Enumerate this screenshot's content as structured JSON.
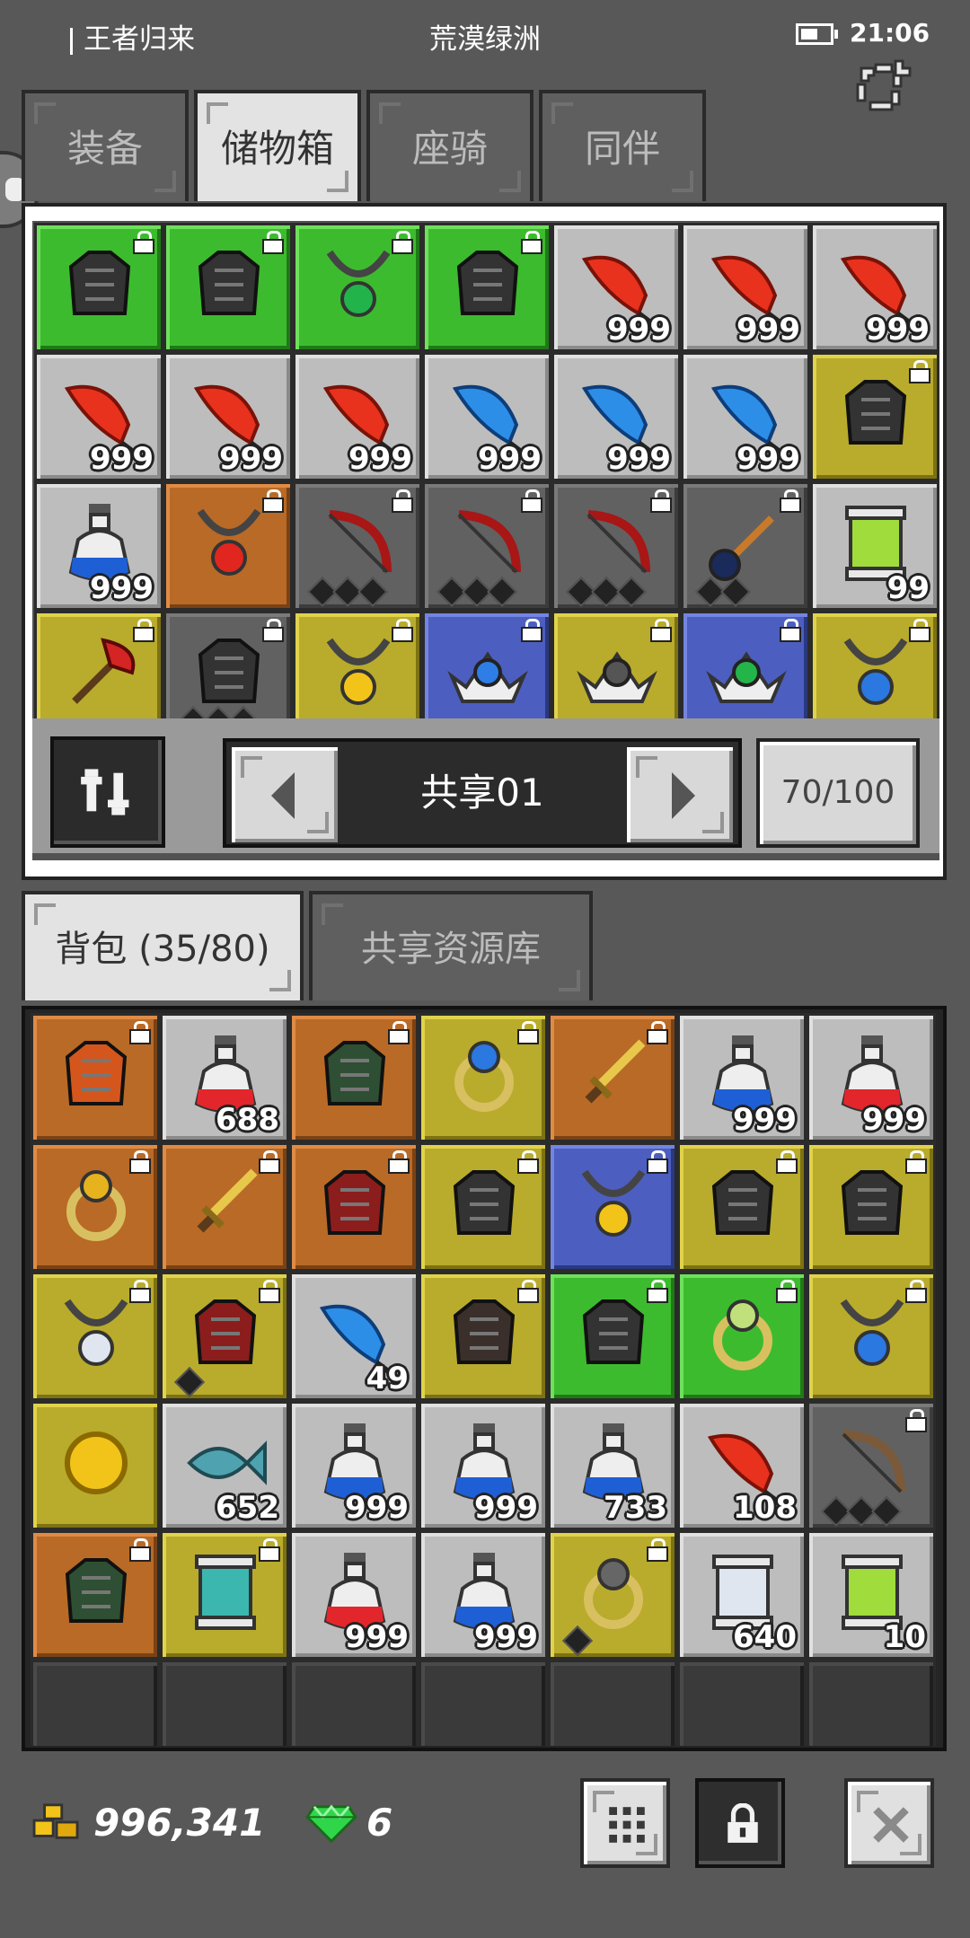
{
  "status_bar": {
    "carrier": "王者归来",
    "location": "荒漠绿洲",
    "time": "21:06"
  },
  "top_tabs": [
    {
      "label": "装备",
      "active": false
    },
    {
      "label": "储物箱",
      "active": true
    },
    {
      "label": "座骑",
      "active": false
    },
    {
      "label": "同伴",
      "active": false
    }
  ],
  "storage": {
    "page_label": "共享01",
    "capacity": "70/100",
    "slots": [
      {
        "bg": "green",
        "icon": "helmet-icon",
        "lock": true,
        "qty": ""
      },
      {
        "bg": "green",
        "icon": "coiled-rope-icon",
        "lock": true,
        "qty": ""
      },
      {
        "bg": "green",
        "icon": "emerald-amulet-icon",
        "lock": true,
        "qty": ""
      },
      {
        "bg": "green",
        "icon": "gauntlet-icon",
        "lock": true,
        "qty": ""
      },
      {
        "bg": "gray",
        "icon": "red-feather-icon",
        "lock": false,
        "qty": "999"
      },
      {
        "bg": "gray",
        "icon": "red-feather-icon",
        "lock": false,
        "qty": "999"
      },
      {
        "bg": "gray",
        "icon": "red-feather-icon",
        "lock": false,
        "qty": "999"
      },
      {
        "bg": "gray",
        "icon": "red-feather-icon",
        "lock": false,
        "qty": "999"
      },
      {
        "bg": "gray",
        "icon": "red-feather-icon",
        "lock": false,
        "qty": "999"
      },
      {
        "bg": "gray",
        "icon": "red-feather-icon",
        "lock": false,
        "qty": "999"
      },
      {
        "bg": "gray",
        "icon": "blue-feather-icon",
        "lock": false,
        "qty": "999"
      },
      {
        "bg": "gray",
        "icon": "blue-feather-icon",
        "lock": false,
        "qty": "999"
      },
      {
        "bg": "gray",
        "icon": "blue-feather-icon",
        "lock": false,
        "qty": "999"
      },
      {
        "bg": "yellow",
        "icon": "chest-armor-icon",
        "lock": true,
        "qty": ""
      },
      {
        "bg": "gray",
        "icon": "blue-potion-icon",
        "lock": false,
        "qty": "999"
      },
      {
        "bg": "orange",
        "icon": "ruby-amulet-icon",
        "lock": true,
        "qty": ""
      },
      {
        "bg": "dark",
        "icon": "red-bow-icon",
        "lock": true,
        "qty": "",
        "dia": 3
      },
      {
        "bg": "dark",
        "icon": "red-bow-icon",
        "lock": true,
        "qty": "",
        "dia": 3
      },
      {
        "bg": "dark",
        "icon": "red-bow-icon",
        "lock": true,
        "qty": "",
        "dia": 3
      },
      {
        "bg": "dark",
        "icon": "staff-icon",
        "lock": true,
        "qty": "",
        "dia": 2
      },
      {
        "bg": "gray",
        "icon": "green-scroll-icon",
        "lock": false,
        "qty": "99"
      },
      {
        "bg": "yellow",
        "icon": "red-axe-icon",
        "lock": true,
        "qty": ""
      },
      {
        "bg": "dark",
        "icon": "dark-armor-icon",
        "lock": true,
        "qty": "",
        "dia": 3
      },
      {
        "bg": "yellow",
        "icon": "gold-amulet-icon",
        "lock": true,
        "qty": ""
      },
      {
        "bg": "blue",
        "icon": "blue-crown-icon",
        "lock": true,
        "qty": ""
      },
      {
        "bg": "yellow",
        "icon": "gray-crown-icon",
        "lock": true,
        "qty": ""
      },
      {
        "bg": "blue",
        "icon": "green-crown-icon",
        "lock": true,
        "qty": ""
      },
      {
        "bg": "yellow",
        "icon": "horned-amulet-icon",
        "lock": true,
        "qty": ""
      }
    ]
  },
  "bag_tabs": [
    {
      "label": "背包 (35/80)",
      "active": true
    },
    {
      "label": "共享资源库",
      "active": false
    }
  ],
  "bag": {
    "slots": [
      {
        "bg": "orange",
        "icon": "fire-armor-icon",
        "lock": true,
        "qty": ""
      },
      {
        "bg": "gray",
        "icon": "red-potion-icon",
        "lock": false,
        "qty": "688"
      },
      {
        "bg": "orange",
        "icon": "green-armor-icon",
        "lock": true,
        "qty": ""
      },
      {
        "bg": "yellow",
        "icon": "sapphire-ring-icon",
        "lock": true,
        "qty": ""
      },
      {
        "bg": "orange",
        "icon": "golden-sword-icon",
        "lock": true,
        "qty": ""
      },
      {
        "bg": "gray",
        "icon": "blue-potion-icon",
        "lock": false,
        "qty": "999"
      },
      {
        "bg": "gray",
        "icon": "red-potion-icon",
        "lock": false,
        "qty": "999"
      },
      {
        "bg": "orange",
        "icon": "gold-ring-icon",
        "lock": true,
        "qty": ""
      },
      {
        "bg": "orange",
        "icon": "dagger-icon",
        "lock": true,
        "qty": ""
      },
      {
        "bg": "orange",
        "icon": "red-hat-icon",
        "lock": true,
        "qty": ""
      },
      {
        "bg": "yellow",
        "icon": "gauntlet-icon",
        "lock": true,
        "qty": ""
      },
      {
        "bg": "blue",
        "icon": "gold-amulet-icon",
        "lock": true,
        "qty": ""
      },
      {
        "bg": "yellow",
        "icon": "dark-armor-icon",
        "lock": true,
        "qty": ""
      },
      {
        "bg": "yellow",
        "icon": "boots-icon",
        "lock": true,
        "qty": ""
      },
      {
        "bg": "yellow",
        "icon": "silver-necklace-icon",
        "lock": true,
        "qty": ""
      },
      {
        "bg": "yellow",
        "icon": "crimson-helmet-icon",
        "lock": true,
        "qty": "",
        "dia": 1
      },
      {
        "bg": "gray",
        "icon": "blue-feather-icon",
        "lock": false,
        "qty": "49"
      },
      {
        "bg": "yellow",
        "icon": "ruby-belt-icon",
        "lock": true,
        "qty": ""
      },
      {
        "bg": "green",
        "icon": "horned-helmet-icon",
        "lock": true,
        "qty": ""
      },
      {
        "bg": "green",
        "icon": "jade-ring-icon",
        "lock": true,
        "qty": ""
      },
      {
        "bg": "yellow",
        "icon": "horned-amulet-icon",
        "lock": true,
        "qty": ""
      },
      {
        "bg": "yellow",
        "icon": "gold-coin-icon",
        "lock": false,
        "qty": ""
      },
      {
        "bg": "gray",
        "icon": "fish-icon",
        "lock": false,
        "qty": "652"
      },
      {
        "bg": "gray",
        "icon": "blue-potion-icon",
        "lock": false,
        "qty": "999"
      },
      {
        "bg": "gray",
        "icon": "blue-potion-icon",
        "lock": false,
        "qty": "999"
      },
      {
        "bg": "gray",
        "icon": "blue-potion-icon",
        "lock": false,
        "qty": "733"
      },
      {
        "bg": "gray",
        "icon": "red-feather-icon",
        "lock": false,
        "qty": "108"
      },
      {
        "bg": "dark",
        "icon": "wood-bow-icon",
        "lock": true,
        "qty": "",
        "dia": 3
      },
      {
        "bg": "orange",
        "icon": "jade-armor-icon",
        "lock": true,
        "qty": ""
      },
      {
        "bg": "yellow",
        "icon": "dragon-scroll-icon",
        "lock": true,
        "qty": ""
      },
      {
        "bg": "gray",
        "icon": "red-potion-icon",
        "lock": false,
        "qty": "999"
      },
      {
        "bg": "gray",
        "icon": "blue-potion-icon",
        "lock": false,
        "qty": "999"
      },
      {
        "bg": "yellow",
        "icon": "iron-ring-icon",
        "lock": true,
        "qty": "",
        "dia": 1
      },
      {
        "bg": "gray",
        "icon": "blank-scroll-icon",
        "lock": false,
        "qty": "640"
      },
      {
        "bg": "gray",
        "icon": "green-scroll-icon",
        "lock": false,
        "qty": "10"
      },
      {
        "bg": "empty",
        "icon": "",
        "lock": false,
        "qty": ""
      },
      {
        "bg": "empty",
        "icon": "",
        "lock": false,
        "qty": ""
      },
      {
        "bg": "empty",
        "icon": "",
        "lock": false,
        "qty": ""
      },
      {
        "bg": "empty",
        "icon": "",
        "lock": false,
        "qty": ""
      },
      {
        "bg": "empty",
        "icon": "",
        "lock": false,
        "qty": ""
      },
      {
        "bg": "empty",
        "icon": "",
        "lock": false,
        "qty": ""
      },
      {
        "bg": "empty",
        "icon": "",
        "lock": false,
        "qty": ""
      }
    ]
  },
  "currency": {
    "gold": "996,341",
    "gems": "6"
  },
  "colors": {
    "slot_gray": "#bdbdbd",
    "slot_green": "#3dbb2e",
    "slot_yellow": "#b9ab2c",
    "slot_orange": "#b96a26",
    "slot_blue": "#4c5fc0",
    "slot_dark": "#616161",
    "background": "#585858"
  }
}
